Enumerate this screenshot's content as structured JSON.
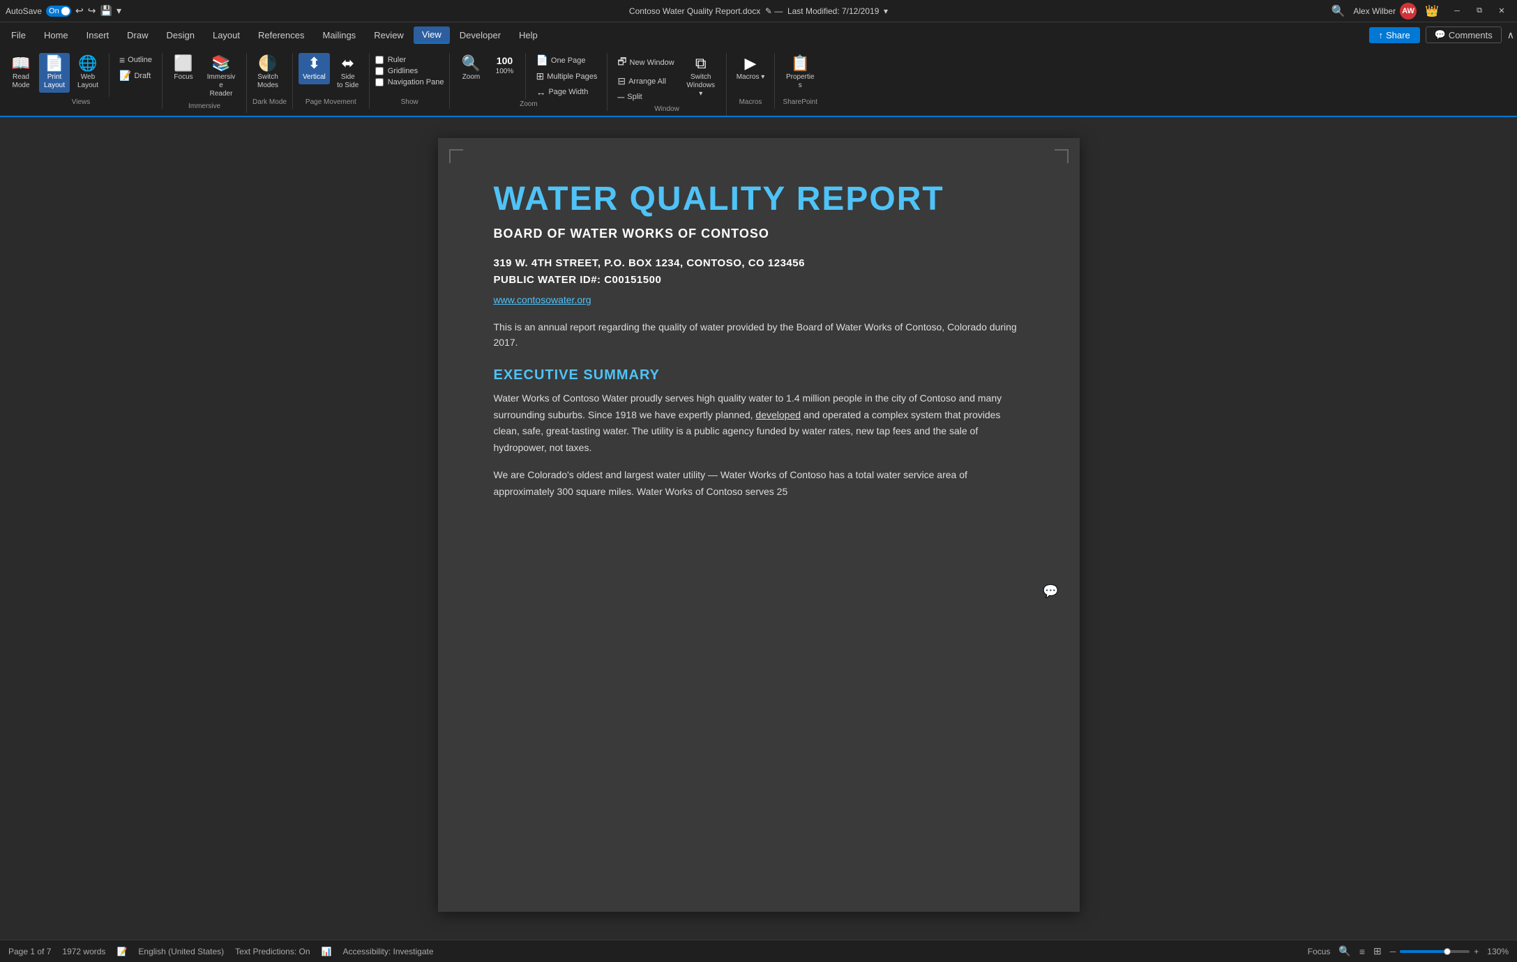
{
  "titlebar": {
    "autosave": "AutoSave",
    "on_label": "On",
    "filename": "Contoso Water Quality Report.docx",
    "last_modified": "Last Modified: 7/12/2019",
    "user": "Alex Wilber",
    "user_initials": "AW",
    "undo_icon": "↩",
    "redo_icon": "↪",
    "save_icon": "💾",
    "search_icon": "🔍",
    "minimize_icon": "─",
    "restore_icon": "⧉",
    "close_icon": "✕"
  },
  "menubar": {
    "items": [
      "File",
      "Home",
      "Insert",
      "Draw",
      "Design",
      "Layout",
      "References",
      "Mailings",
      "Review",
      "View",
      "Developer",
      "Help"
    ],
    "active": "View",
    "share_label": "Share",
    "comments_label": "Comments"
  },
  "ribbon": {
    "groups": [
      {
        "label": "Views",
        "buttons": [
          {
            "id": "read-mode",
            "icon": "📖",
            "label": "Read\nMode"
          },
          {
            "id": "print-layout",
            "icon": "📄",
            "label": "Print\nLayout",
            "active": true
          },
          {
            "id": "web-layout",
            "icon": "🌐",
            "label": "Web\nLayout"
          }
        ],
        "small_buttons": [
          {
            "id": "outline",
            "icon": "≡",
            "label": "Outline"
          },
          {
            "id": "draft",
            "icon": "📝",
            "label": "Draft"
          }
        ]
      },
      {
        "label": "Immersive",
        "buttons": [
          {
            "id": "focus",
            "icon": "⬜",
            "label": "Focus"
          },
          {
            "id": "immersive-reader",
            "icon": "📚",
            "label": "Immersive\nReader"
          }
        ]
      },
      {
        "label": "Dark Mode",
        "buttons": [
          {
            "id": "switch-modes",
            "icon": "🌗",
            "label": "Switch\nModes"
          }
        ]
      },
      {
        "label": "Page Movement",
        "buttons": [
          {
            "id": "vertical",
            "icon": "⬍",
            "label": "Vertical",
            "active": true
          },
          {
            "id": "side-to-side",
            "icon": "⬌",
            "label": "Side\nto Side"
          }
        ]
      },
      {
        "label": "Show",
        "checkboxes": [
          {
            "id": "ruler",
            "label": "Ruler",
            "checked": false
          },
          {
            "id": "gridlines",
            "label": "Gridlines",
            "checked": false
          },
          {
            "id": "nav-pane",
            "label": "Navigation Pane",
            "checked": false
          }
        ]
      },
      {
        "label": "Zoom",
        "buttons": [
          {
            "id": "zoom",
            "icon": "🔍",
            "label": "Zoom"
          },
          {
            "id": "zoom-100",
            "icon": "100",
            "label": "100%"
          }
        ],
        "small_buttons": [
          {
            "id": "one-page",
            "icon": "📄",
            "label": "One Page"
          },
          {
            "id": "multiple-pages",
            "icon": "⊞",
            "label": "Multiple Pages"
          },
          {
            "id": "page-width",
            "icon": "↔",
            "label": "Page Width"
          }
        ]
      },
      {
        "label": "Window",
        "buttons": [
          {
            "id": "switch-windows",
            "icon": "⧉",
            "label": "Switch\nWindows ▾"
          }
        ],
        "small_buttons": [
          {
            "id": "new-window",
            "icon": "🗗",
            "label": "New Window"
          },
          {
            "id": "arrange-all",
            "icon": "⊟",
            "label": "Arrange All"
          },
          {
            "id": "split",
            "icon": "─",
            "label": "Split"
          }
        ]
      },
      {
        "label": "Macros",
        "buttons": [
          {
            "id": "macros",
            "icon": "▶",
            "label": "Macros ▾"
          }
        ]
      },
      {
        "label": "SharePoint",
        "buttons": [
          {
            "id": "properties",
            "icon": "📋",
            "label": "Properties"
          }
        ]
      }
    ]
  },
  "document": {
    "title": "WATER QUALITY REPORT",
    "org": "BOARD OF WATER WORKS OF CONTOSO",
    "address1": "319 W. 4TH STREET, P.O. BOX 1234, CONTOSO, CO 123456",
    "address2": "PUBLIC WATER ID#: C00151500",
    "website": "www.contosowater.org",
    "intro": "This is an annual report regarding the quality of water provided by the Board of Water Works of Contoso, Colorado during 2017.",
    "section1_heading": "EXECUTIVE SUMMARY",
    "section1_p1": "Water Works of Contoso Water proudly serves high quality water to 1.4 million people in the city of Contoso and many surrounding suburbs. Since 1918 we have expertly planned, developed and operated a complex system that provides clean, safe, great-tasting water. The utility is a public agency funded by water rates, new tap fees and the sale of hydropower, not taxes.",
    "section1_p2": "We are Colorado's oldest and largest water utility — Water Works of Contoso has a total water service area of approximately 300 square miles. Water Works of Contoso serves 25"
  },
  "statusbar": {
    "page": "Page 1 of 7",
    "words": "1972 words",
    "language": "English (United States)",
    "text_predictions": "Text Predictions: On",
    "accessibility": "Accessibility: Investigate",
    "focus": "Focus",
    "zoom_percent": "130%",
    "zoom_minus": "─",
    "zoom_plus": "+"
  }
}
